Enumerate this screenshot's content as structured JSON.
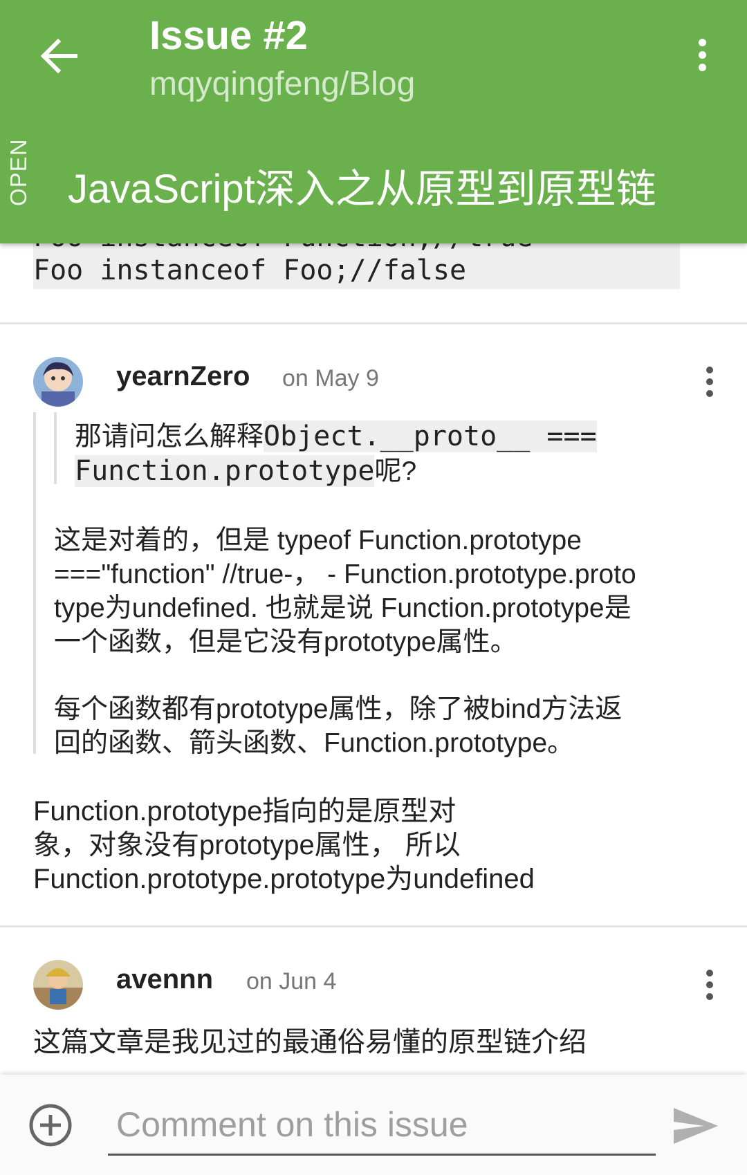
{
  "appbar": {
    "title": "Issue #2",
    "subtitle": "mqyqingfeng/Blog",
    "state": "OPEN",
    "issue_title": "JavaScript深入之从原型到原型链",
    "back_icon": "arrow-left-icon",
    "more_icon": "more-vert-icon",
    "color": "#6ab04c"
  },
  "code": {
    "line_partial": "Foo instanceof Function;//true",
    "line": "Foo instanceof Foo;//false"
  },
  "comments": [
    {
      "author": "yearnZero",
      "date": "on May 9",
      "quote": {
        "part1": "那请问怎么解释",
        "code1": "Object.__proto__ ===",
        "code2": "Function.prototype",
        "part2": "呢?"
      },
      "answer_lines": [
        "这是对着的，但是 typeof Function.prototype",
        "===\"function\" //true-， - Function.prototype.proto",
        "type为undefined. 也就是说 Function.prototype是",
        "一个函数，但是它没有prototype属性。"
      ],
      "answer2_lines": [
        "每个函数都有prototype属性，除了被bind方法返",
        "回的函数、箭头函数、Function.prototype。"
      ],
      "body_lines": [
        "Function.prototype指向的是原型对",
        "象，对象没有prototype属性， 所以",
        "Function.prototype.prototype为undefined"
      ]
    },
    {
      "author": "avennn",
      "date": "on Jun 4",
      "body_lines": [
        "这篇文章是我见过的最通俗易懂的原型链介绍"
      ]
    }
  ],
  "composer": {
    "placeholder": "Comment on this issue",
    "add_icon": "add-circle-icon",
    "send_icon": "send-icon"
  }
}
